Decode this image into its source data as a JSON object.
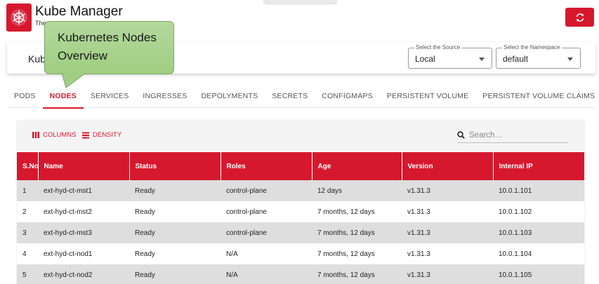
{
  "app": {
    "title": "Kube Manager",
    "subtitle": "The",
    "brand_color": "#d6182f"
  },
  "icons": {
    "logo": "kubernetes-wheel-icon",
    "refresh": "refresh-icon",
    "columns": "columns-icon",
    "density": "density-icon",
    "search": "search-icon"
  },
  "toolbar": {
    "cluster_label": "Kub",
    "source": {
      "legend": "Select the Source",
      "value": "Local"
    },
    "namespace": {
      "legend": "Select the Namespace",
      "value": "default"
    }
  },
  "callout": {
    "line1": "Kubernetes Nodes",
    "line2": "Overview",
    "color": "#a8d38c"
  },
  "tabs": [
    {
      "label": "PODS"
    },
    {
      "label": "NODES",
      "active": true
    },
    {
      "label": "SERVICES"
    },
    {
      "label": "INGRESSES"
    },
    {
      "label": "DEPOLYMENTS"
    },
    {
      "label": "SECRETS"
    },
    {
      "label": "CONFIGMAPS"
    },
    {
      "label": "PERSISTENT VOLUME"
    },
    {
      "label": "PERSISTENT VOLUME CLAIMS"
    }
  ],
  "grid": {
    "columns_label": "COLUMNS",
    "density_label": "DENSITY",
    "search_placeholder": "Search…",
    "headers": [
      "S.No",
      "Name",
      "Status",
      "Roles",
      "Age",
      "Version",
      "Internal IP"
    ],
    "rows": [
      [
        "1",
        "ext-hyd-ct-mst1",
        "Ready",
        "control-plane",
        "12 days",
        "v1.31.3",
        "10.0.1.101"
      ],
      [
        "2",
        "ext-hyd-ct-mst2",
        "Ready",
        "control-plane",
        "7 months, 12 days",
        "v1.31.3",
        "10.0.1.102"
      ],
      [
        "3",
        "ext-hyd-ct-mst3",
        "Ready",
        "control-plane",
        "7 months, 12 days",
        "v1.31.3",
        "10.0.1.103"
      ],
      [
        "4",
        "ext-hyd-ct-nod1",
        "Ready",
        "N/A",
        "7 months, 12 days",
        "v1.31.3",
        "10.0.1.104"
      ],
      [
        "5",
        "ext-hyd-ct-nod2",
        "Ready",
        "N/A",
        "7 months, 12 days",
        "v1.31.3",
        "10.0.1.105"
      ]
    ]
  }
}
